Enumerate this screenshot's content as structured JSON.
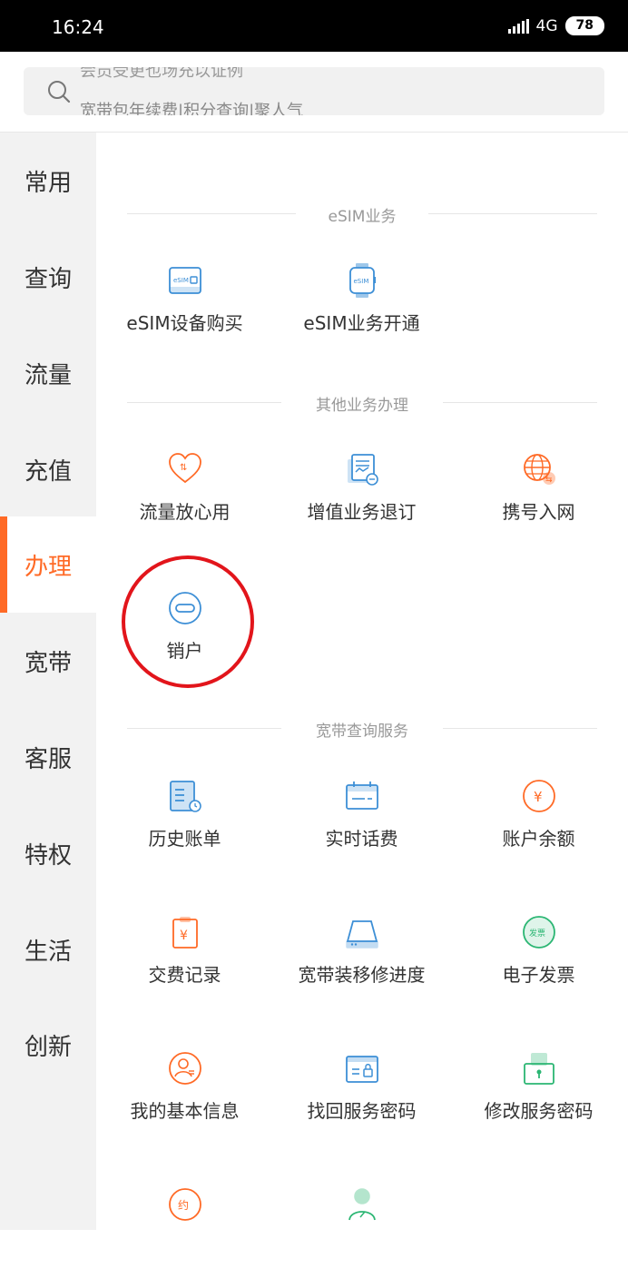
{
  "status": {
    "time": "16:24",
    "network": "4G",
    "battery": "78"
  },
  "search": {
    "hint_top": "会员受更也场充以证例",
    "hint": "宽带包年续费|积分查询|聚人气"
  },
  "sidebar": {
    "items": [
      {
        "label": "常用"
      },
      {
        "label": "查询"
      },
      {
        "label": "流量"
      },
      {
        "label": "充值"
      },
      {
        "label": "办理"
      },
      {
        "label": "宽带"
      },
      {
        "label": "客服"
      },
      {
        "label": "特权"
      },
      {
        "label": "生活"
      },
      {
        "label": "创新"
      }
    ],
    "active_index": 4
  },
  "sections": [
    {
      "title": "eSIM业务",
      "items": [
        {
          "label": "eSIM设备购买",
          "icon": "esim-card-icon"
        },
        {
          "label": "eSIM业务开通",
          "icon": "esim-watch-icon"
        }
      ]
    },
    {
      "title": "其他业务办理",
      "items": [
        {
          "label": "流量放心用",
          "icon": "heart-data-icon"
        },
        {
          "label": "增值业务退订",
          "icon": "document-icon"
        },
        {
          "label": "携号入网",
          "icon": "globe-icon"
        },
        {
          "label": "销户",
          "icon": "minus-circle-icon"
        }
      ]
    },
    {
      "title": "宽带查询服务",
      "items": [
        {
          "label": "历史账单",
          "icon": "bill-icon"
        },
        {
          "label": "实时话费",
          "icon": "calendar-card-icon"
        },
        {
          "label": "账户余额",
          "icon": "yen-circle-icon"
        },
        {
          "label": "交费记录",
          "icon": "clipboard-yen-icon"
        },
        {
          "label": "宽带装移修进度",
          "icon": "router-icon"
        },
        {
          "label": "电子发票",
          "icon": "invoice-stamp-icon"
        },
        {
          "label": "我的基本信息",
          "icon": "user-circle-icon"
        },
        {
          "label": "找回服务密码",
          "icon": "password-card-icon"
        },
        {
          "label": "修改服务密码",
          "icon": "lock-icon"
        },
        {
          "label": "",
          "icon": "appointment-icon"
        },
        {
          "label": "",
          "icon": "person-edit-icon"
        }
      ]
    }
  ],
  "colors": {
    "accent": "#ff6a26",
    "icon_blue": "#3d8fd6",
    "icon_orange": "#ff6a26",
    "icon_green": "#2bb673",
    "highlight": "#e2151b"
  }
}
